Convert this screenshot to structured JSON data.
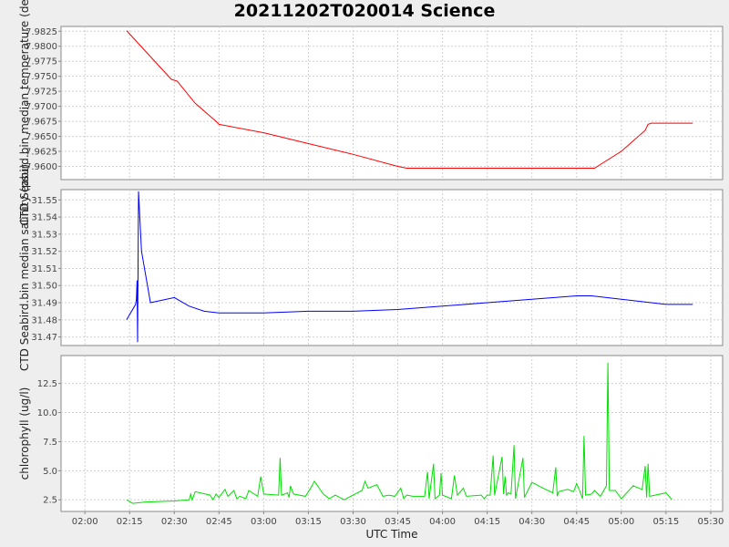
{
  "title": "20211202T020014 Science",
  "colors": {
    "background": "#eeeeee",
    "plot_background": "#ffffff",
    "grid": "#d0d0d0"
  },
  "chart_data": {
    "type": "line",
    "title": "20211202T020014 Science",
    "xlabel": "UTC Time",
    "x_unit": "time of day (HH:MM UTC)",
    "xlim": [
      "01:52",
      "05:34"
    ],
    "x_ticks": [
      "02:00",
      "02:15",
      "02:30",
      "02:45",
      "03:00",
      "03:15",
      "03:30",
      "03:45",
      "04:00",
      "04:15",
      "04:30",
      "04:45",
      "05:00",
      "05:15",
      "05:30"
    ],
    "grid": true,
    "subplots": [
      {
        "ylabel": "CTD Seabird.bin median temperature (degC)",
        "ylim": [
          7.9578,
          7.9833
        ],
        "y_ticks": [
          "7.9600",
          "7.9625",
          "7.9650",
          "7.9675",
          "7.9700",
          "7.9725",
          "7.9750",
          "7.9775",
          "7.9800",
          "7.9825"
        ],
        "y_tick_values": [
          7.96,
          7.9625,
          7.965,
          7.9675,
          7.97,
          7.9725,
          7.975,
          7.9775,
          7.98,
          7.9825
        ],
        "series": [
          {
            "color": "#ff0000",
            "points": [
              [
                "02:14",
                7.9826
              ],
              [
                "02:29",
                7.9745
              ],
              [
                "02:31",
                7.9742
              ],
              [
                "02:37",
                7.9705
              ],
              [
                "02:44",
                7.9675
              ],
              [
                "02:45",
                7.967
              ],
              [
                "03:00",
                7.9656
              ],
              [
                "03:15",
                7.9638
              ],
              [
                "03:30",
                7.962
              ],
              [
                "03:45",
                7.96
              ],
              [
                "03:48",
                7.9597
              ],
              [
                "04:00",
                7.9597
              ],
              [
                "04:15",
                7.9597
              ],
              [
                "04:30",
                7.9597
              ],
              [
                "04:51",
                7.9597
              ],
              [
                "05:00",
                7.9625
              ],
              [
                "05:08",
                7.966
              ],
              [
                "05:09",
                7.967
              ],
              [
                "05:10",
                7.9672
              ],
              [
                "05:24",
                7.9672
              ]
            ]
          }
        ]
      },
      {
        "ylabel": "CTD Seabird.bin median salinity (psu)",
        "ylim": [
          31.465,
          31.556
        ],
        "y_ticks": [
          "31.47",
          "31.48",
          "31.49",
          "31.50",
          "31.51",
          "31.52",
          "31.53",
          "31.54",
          "31.55"
        ],
        "y_tick_values": [
          31.47,
          31.48,
          31.49,
          31.5,
          31.51,
          31.52,
          31.53,
          31.54,
          31.55
        ],
        "series": [
          {
            "color": "#0000ff",
            "points": [
              [
                "02:14",
                31.48
              ],
              [
                "02:17",
                31.489
              ],
              [
                "02:17.3",
                31.492
              ],
              [
                "02:17.5",
                31.503
              ],
              [
                "02:17.7",
                31.467
              ],
              [
                "02:18",
                31.555
              ],
              [
                "02:19",
                31.52
              ],
              [
                "02:22",
                31.49
              ],
              [
                "02:30",
                31.493
              ],
              [
                "02:35",
                31.488
              ],
              [
                "02:40",
                31.485
              ],
              [
                "02:45",
                31.484
              ],
              [
                "03:00",
                31.484
              ],
              [
                "03:15",
                31.485
              ],
              [
                "03:30",
                31.485
              ],
              [
                "03:45",
                31.486
              ],
              [
                "04:00",
                31.488
              ],
              [
                "04:15",
                31.49
              ],
              [
                "04:30",
                31.492
              ],
              [
                "04:45",
                31.494
              ],
              [
                "04:50",
                31.494
              ],
              [
                "05:00",
                31.492
              ],
              [
                "05:05",
                31.491
              ],
              [
                "05:10",
                31.49
              ],
              [
                "05:15",
                31.489
              ],
              [
                "05:24",
                31.489
              ]
            ]
          }
        ]
      },
      {
        "ylabel": "chlorophyll (ug/l)",
        "ylim": [
          1.5,
          14.9
        ],
        "y_ticks": [
          "2.5",
          "5.0",
          "7.5",
          "10.0",
          "12.5"
        ],
        "y_tick_values": [
          2.5,
          5.0,
          7.5,
          10.0,
          12.5
        ],
        "series": [
          {
            "color": "#00e000",
            "points": [
              [
                "02:14",
                2.5
              ],
              [
                "02:16",
                2.2
              ],
              [
                "02:20",
                2.3
              ],
              [
                "02:30",
                2.4
              ],
              [
                "02:35",
                2.5
              ],
              [
                "02:35.5",
                3.0
              ],
              [
                "02:36",
                2.5
              ],
              [
                "02:37",
                3.2
              ],
              [
                "02:42",
                2.9
              ],
              [
                "02:43",
                2.5
              ],
              [
                "02:44",
                3.0
              ],
              [
                "02:45",
                2.7
              ],
              [
                "02:47",
                3.4
              ],
              [
                "02:48",
                2.8
              ],
              [
                "02:50",
                3.3
              ],
              [
                "02:51",
                2.6
              ],
              [
                "02:52",
                2.8
              ],
              [
                "02:54",
                2.6
              ],
              [
                "02:55",
                3.3
              ],
              [
                "02:58",
                2.8
              ],
              [
                "02:59",
                4.5
              ],
              [
                "03:00",
                3.0
              ],
              [
                "03:05",
                2.9
              ],
              [
                "03:05.5",
                6.1
              ],
              [
                "03:06",
                2.9
              ],
              [
                "03:08",
                3.1
              ],
              [
                "03:08.5",
                2.7
              ],
              [
                "03:09",
                3.7
              ],
              [
                "03:10",
                3.0
              ],
              [
                "03:14",
                2.8
              ],
              [
                "03:16",
                3.6
              ],
              [
                "03:17",
                4.1
              ],
              [
                "03:20",
                3.0
              ],
              [
                "03:22",
                2.6
              ],
              [
                "03:24",
                2.9
              ],
              [
                "03:27",
                2.5
              ],
              [
                "03:33",
                3.3
              ],
              [
                "03:34",
                4.1
              ],
              [
                "03:35",
                3.5
              ],
              [
                "03:38",
                3.8
              ],
              [
                "03:40",
                2.8
              ],
              [
                "03:42",
                2.9
              ],
              [
                "03:44",
                2.8
              ],
              [
                "03:46",
                3.5
              ],
              [
                "03:47",
                2.6
              ],
              [
                "03:48",
                2.9
              ],
              [
                "03:50",
                2.8
              ],
              [
                "03:54",
                2.8
              ],
              [
                "03:55",
                4.9
              ],
              [
                "03:55.5",
                2.6
              ],
              [
                "03:57",
                5.6
              ],
              [
                "03:57.5",
                2.6
              ],
              [
                "03:59",
                2.9
              ],
              [
                "03:59.5",
                4.8
              ],
              [
                "04:00",
                2.9
              ],
              [
                "04:03",
                2.6
              ],
              [
                "04:04",
                4.6
              ],
              [
                "04:05",
                2.9
              ],
              [
                "04:07",
                3.5
              ],
              [
                "04:08",
                2.8
              ],
              [
                "04:13",
                2.9
              ],
              [
                "04:14",
                2.6
              ],
              [
                "04:15",
                2.9
              ],
              [
                "04:16",
                2.9
              ],
              [
                "04:17",
                6.3
              ],
              [
                "04:17.5",
                2.9
              ],
              [
                "04:20",
                6.2
              ],
              [
                "04:20.5",
                3.0
              ],
              [
                "04:21",
                4.5
              ],
              [
                "04:21.5",
                2.9
              ],
              [
                "04:22",
                3.1
              ],
              [
                "04:23",
                3.0
              ],
              [
                "04:24",
                7.2
              ],
              [
                "04:24.5",
                2.6
              ],
              [
                "04:27",
                6.1
              ],
              [
                "04:27.5",
                2.7
              ],
              [
                "04:30",
                4.0
              ],
              [
                "04:33",
                3.6
              ],
              [
                "04:37",
                3.1
              ],
              [
                "04:38",
                5.3
              ],
              [
                "04:38.5",
                2.8
              ],
              [
                "04:39",
                3.2
              ],
              [
                "04:42",
                3.4
              ],
              [
                "04:44",
                3.2
              ],
              [
                "04:45",
                3.9
              ],
              [
                "04:46",
                3.3
              ],
              [
                "04:47",
                2.6
              ],
              [
                "04:47.5",
                8.0
              ],
              [
                "04:48",
                2.9
              ],
              [
                "04:50",
                3.0
              ],
              [
                "04:51",
                3.3
              ],
              [
                "04:53",
                2.8
              ],
              [
                "04:55",
                3.7
              ],
              [
                "04:55.5",
                14.3
              ],
              [
                "04:56",
                3.3
              ],
              [
                "04:58",
                3.3
              ],
              [
                "05:00",
                2.6
              ],
              [
                "05:04",
                3.7
              ],
              [
                "05:07",
                3.4
              ],
              [
                "05:08",
                5.4
              ],
              [
                "05:08.5",
                2.7
              ],
              [
                "05:09",
                5.6
              ],
              [
                "05:09.5",
                2.8
              ],
              [
                "05:15",
                3.1
              ],
              [
                "05:17",
                2.5
              ]
            ]
          }
        ]
      }
    ]
  }
}
